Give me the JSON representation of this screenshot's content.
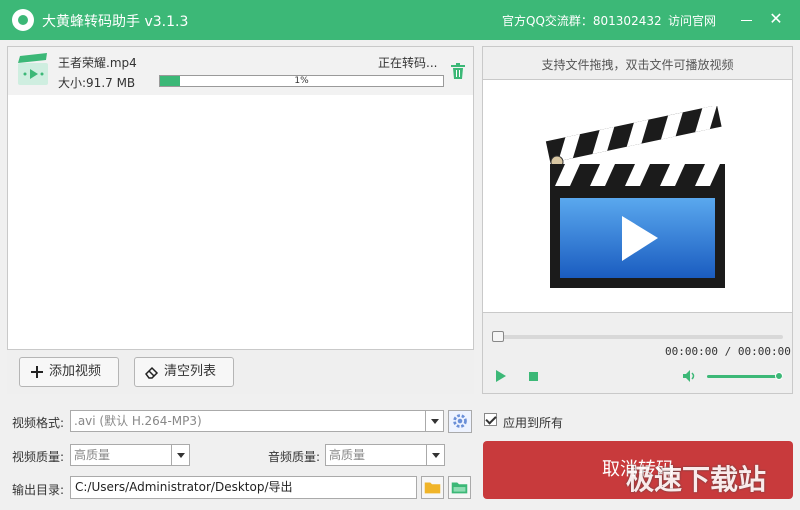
{
  "app": {
    "title": "大黄蜂转码助手 v3.1.3",
    "qq_group": "官方QQ交流群：801302432",
    "visit_site": "访问官网",
    "close_glyph": "✕"
  },
  "file_list": {
    "items": [
      {
        "name": "王者荣耀.mp4",
        "size": "大小:91.7 MB",
        "status": "正在转码...",
        "progress_text": "1%",
        "progress": 0.07
      }
    ]
  },
  "toolbar": {
    "add_label": "添加视频",
    "clear_label": "清空列表"
  },
  "preview": {
    "hint": "支持文件拖拽，双击文件可播放视频",
    "time": "00:00:00 / 00:00:00",
    "seek": 0,
    "volume": 0.95
  },
  "settings": {
    "format_label": "视频格式:",
    "format_value": ".avi (默认 H.264-MP3)",
    "apply_all_label": "应用到所有",
    "apply_all_checked": true,
    "video_quality_label": "视频质量:",
    "video_quality_value": "高质量",
    "audio_quality_label": "音频质量:",
    "audio_quality_value": "高质量",
    "output_label": "输出目录:",
    "output_path": "C:/Users/Administrator/Desktop/导出"
  },
  "actions": {
    "cancel_label": "取消转码"
  },
  "watermark": "极速下载站",
  "colors": {
    "accent": "#3cb877",
    "cancel": "#c83a3c",
    "folder_yellow": "#f0b429",
    "folder_green": "#3cb877"
  },
  "icons": {
    "logo": "bee-logo-icon",
    "trash": "trash-icon",
    "add": "plus-icon",
    "clear": "eraser-icon",
    "play": "play-icon",
    "stop": "stop-icon",
    "volume": "volume-icon",
    "settings": "gear-icon",
    "folder_open": "folder-icon",
    "folder_go": "folder-open-icon",
    "preview": "clapperboard-icon"
  }
}
